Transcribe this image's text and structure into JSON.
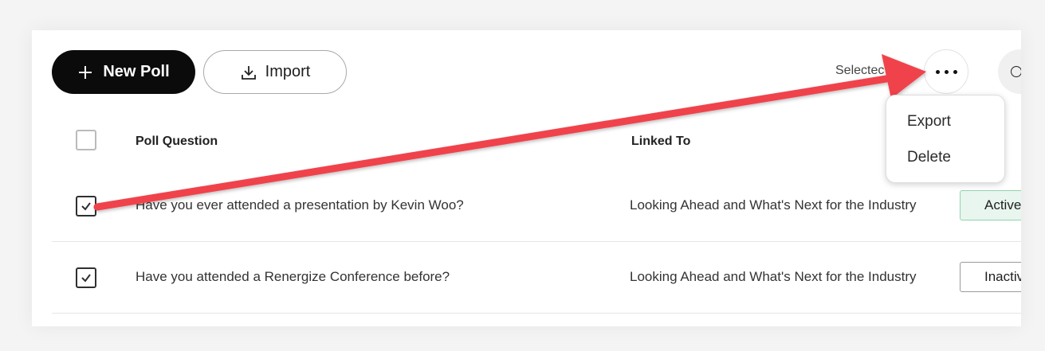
{
  "toolbar": {
    "new_poll_label": "New Poll",
    "import_label": "Import",
    "selected_text": "Selectec"
  },
  "table": {
    "headers": {
      "question": "Poll Question",
      "linked_to": "Linked To"
    },
    "rows": [
      {
        "checked": true,
        "question": "Have you ever attended a presentation by Kevin Woo?",
        "linked_to": "Looking Ahead and What's Next for the Industry",
        "status": "Active"
      },
      {
        "checked": true,
        "question": "Have you attended a Renergize Conference before?",
        "linked_to": "Looking Ahead and What's Next for the Industry",
        "status": "Inactive"
      }
    ]
  },
  "more_menu": {
    "items": [
      "Export",
      "Delete"
    ]
  },
  "colors": {
    "annotation_arrow": "#f0434c",
    "primary_button": "#0b0b0b",
    "active_badge_bg": "#e9f6ef",
    "active_badge_border": "#8fd4ad"
  },
  "icons": [
    "plus-icon",
    "download-icon",
    "more-horizontal-icon",
    "checkmark-icon"
  ]
}
